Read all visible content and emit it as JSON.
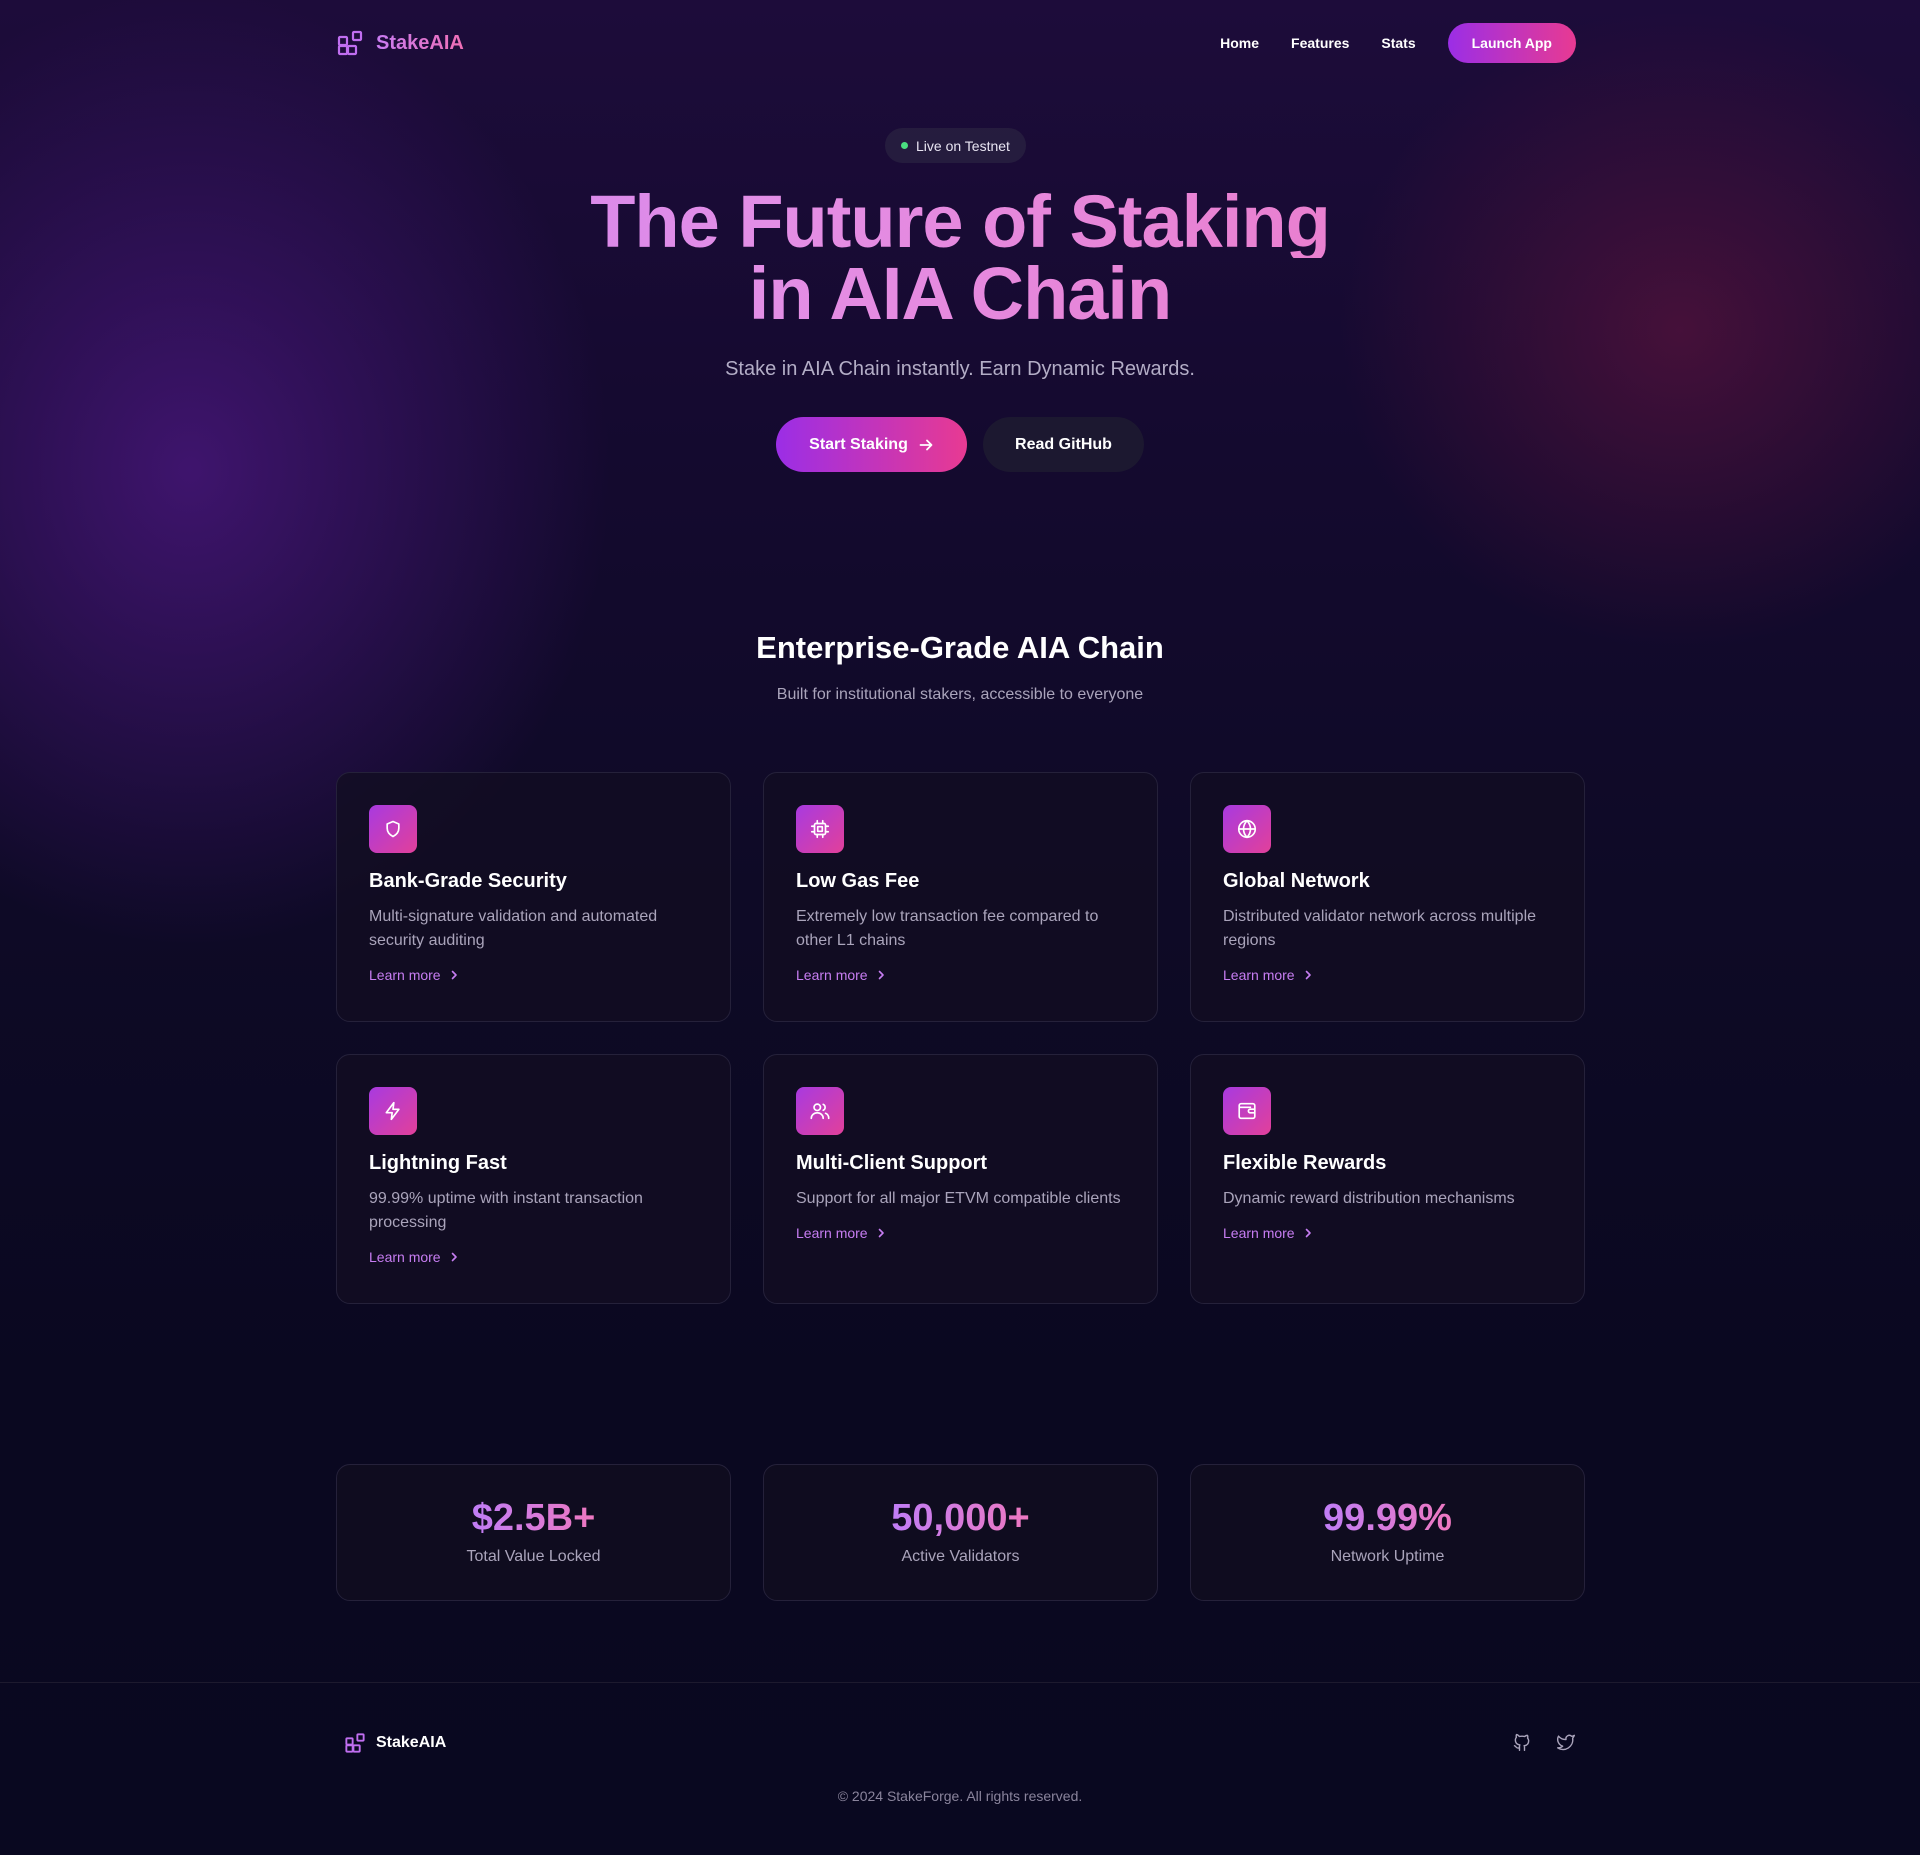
{
  "brand": {
    "name": "StakeAIA"
  },
  "nav": {
    "links": [
      "Home",
      "Features",
      "Stats"
    ],
    "launch_label": "Launch App"
  },
  "hero": {
    "badge": "Live on Testnet",
    "title_line1": "The Future of Staking",
    "title_line2": "in AIA Chain",
    "subtitle": "Stake in AIA Chain instantly. Earn Dynamic Rewards.",
    "primary_cta": "Start Staking",
    "secondary_cta": "Read GitHub"
  },
  "features": {
    "title": "Enterprise-Grade AIA Chain",
    "subtitle": "Built for institutional stakers, accessible to everyone",
    "cards": [
      {
        "icon": "shield-icon",
        "title": "Bank-Grade Security",
        "desc": "Multi-signature validation and automated security auditing",
        "link": "Learn more"
      },
      {
        "icon": "cpu-icon",
        "title": "Low Gas Fee",
        "desc": "Extremely low transaction fee compared to other L1 chains",
        "link": "Learn more"
      },
      {
        "icon": "globe-icon",
        "title": "Global Network",
        "desc": "Distributed validator network across multiple regions",
        "link": "Learn more"
      },
      {
        "icon": "zap-icon",
        "title": "Lightning Fast",
        "desc": "99.99% uptime with instant transaction processing",
        "link": "Learn more"
      },
      {
        "icon": "users-icon",
        "title": "Multi-Client Support",
        "desc": "Support for all major ETVM compatible clients",
        "link": "Learn more"
      },
      {
        "icon": "wallet-icon",
        "title": "Flexible Rewards",
        "desc": "Dynamic reward distribution mechanisms",
        "link": "Learn more"
      }
    ]
  },
  "stats": [
    {
      "value": "$2.5B+",
      "label": "Total Value Locked"
    },
    {
      "value": "50,000+",
      "label": "Active Validators"
    },
    {
      "value": "99.99%",
      "label": "Network Uptime"
    }
  ],
  "footer": {
    "brand": "StakeAIA",
    "copyright": "© 2024 StakeForge. All rights reserved."
  },
  "colors": {
    "accent_start": "#9b2ee6",
    "accent_end": "#e83a92",
    "link": "#c77df2",
    "live_dot": "#4ade80",
    "background": "#0a0820"
  }
}
